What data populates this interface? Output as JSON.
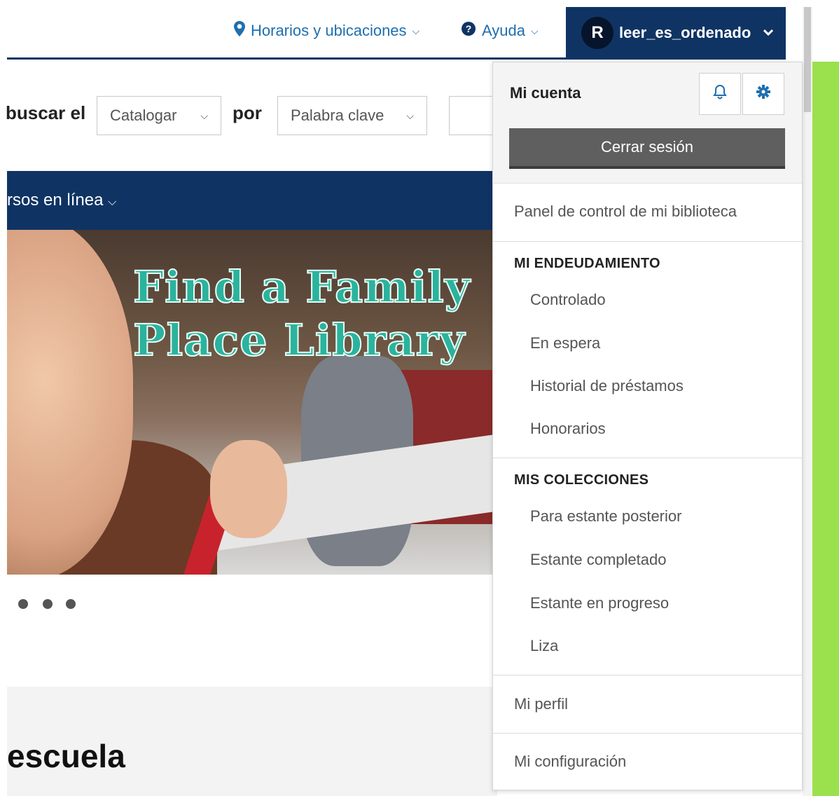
{
  "header": {
    "locations_label": "Horarios y ubicaciones",
    "help_label": "Ayuda",
    "avatar_initial": "R",
    "username": "leer_es_ordenado"
  },
  "search": {
    "label_prefix": "buscar el",
    "scope_value": "Catalogar",
    "by_label": "por",
    "type_value": "Palabra clave"
  },
  "nav": {
    "partial_item": "rsos en línea"
  },
  "hero": {
    "title_line1": "Find a Family",
    "title_line2": "Place Library"
  },
  "section": {
    "partial_heading": "escuela"
  },
  "account_menu": {
    "title": "Mi cuenta",
    "logout_label": "Cerrar sesión",
    "dashboard_label": "Panel de control de mi biblioteca",
    "borrowing_section": "MI ENDEUDAMIENTO",
    "borrowing_items": [
      "Controlado",
      "En espera",
      "Historial de préstamos",
      "Honorarios"
    ],
    "collections_section": "MIS COLECCIONES",
    "collection_items": [
      "Para estante posterior",
      "Estante completado",
      "Estante en progreso",
      "Liza"
    ],
    "profile_label": "Mi perfil",
    "settings_label": "Mi configuración"
  },
  "colors": {
    "navy": "#0f3464",
    "link_blue": "#1f6fae",
    "logout_gray": "#5f5f5f",
    "accent_green": "#9be04d",
    "hero_teal": "#2bb39d"
  },
  "icons": [
    "map-marker-icon",
    "help-circle-icon",
    "chevron-down-icon",
    "bell-icon",
    "gear-icon"
  ]
}
